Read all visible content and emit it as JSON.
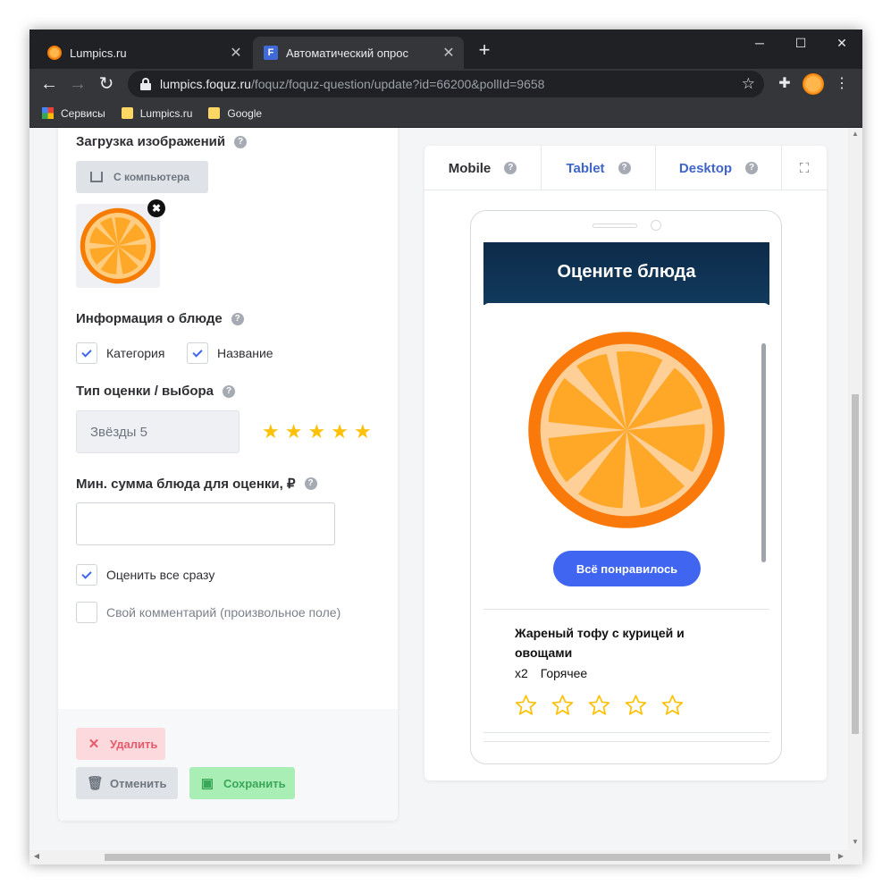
{
  "browser": {
    "tabs": [
      {
        "title": "Lumpics.ru",
        "close": "✕"
      },
      {
        "title": "Автоматический опрос",
        "close": "✕",
        "favicon_letter": "F"
      }
    ],
    "new_tab": "+",
    "window_controls": {
      "minimize": "─",
      "maximize": "☐",
      "close": "✕"
    },
    "url_host": "lumpics.foquz.ru",
    "url_path": "/foquz/foquz-question/update?id=66200&pollId=9658",
    "bookmarks": [
      "Сервисы",
      "Lumpics.ru",
      "Google"
    ]
  },
  "form": {
    "image_upload": {
      "title": "Загрузка изображений",
      "button": "С компьютера",
      "remove": "✖"
    },
    "dish_info": {
      "title": "Информация о блюде",
      "options": [
        {
          "label": "Категория",
          "checked": true
        },
        {
          "label": "Название",
          "checked": true
        }
      ]
    },
    "rating_type": {
      "title": "Тип оценки / выбора",
      "value": "Звёзды 5",
      "stars": [
        "★",
        "★",
        "★",
        "★",
        "★"
      ]
    },
    "min_sum": {
      "title": "Мин. сумма блюда для оценки, ₽",
      "value": ""
    },
    "rate_all": {
      "label": "Оценить все сразу",
      "checked": true
    },
    "own_comment": {
      "label": "Свой комментарий (произвольное поле)",
      "checked": false
    },
    "help_mark": "?",
    "buttons": {
      "delete": "Удалить",
      "cancel": "Отменить",
      "save": "Сохранить"
    }
  },
  "preview": {
    "tabs": {
      "mobile": "Mobile",
      "tablet": "Tablet",
      "desktop": "Desktop"
    },
    "active_tab": "mobile",
    "screen_title": "Оцените блюда",
    "like_button": "Всё понравилось",
    "dish": {
      "name": "Жареный тофу с курицей и овощами",
      "qty": "x2",
      "category": "Горячее",
      "rating": 0,
      "max_rating": 5
    }
  },
  "colors": {
    "accent": "#3f65f1",
    "star": "#ffc107",
    "orange": "#f57c00"
  }
}
